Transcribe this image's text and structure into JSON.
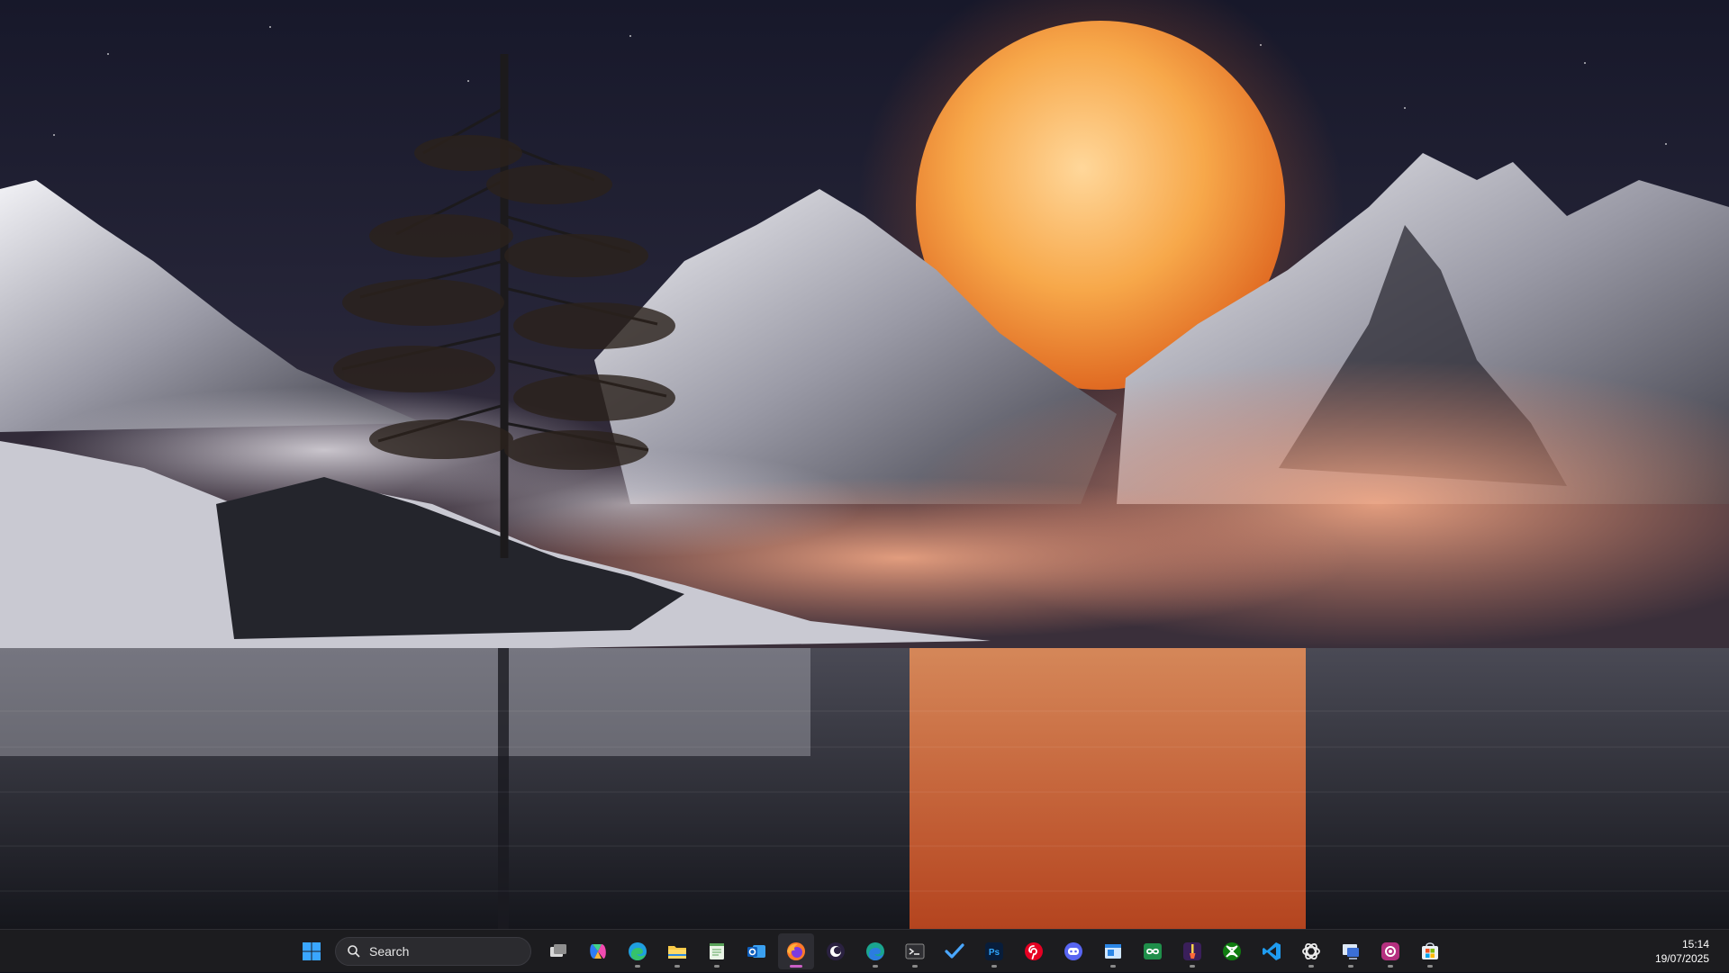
{
  "desktop": {
    "wallpaper": "night-mountain-lake-with-full-moon",
    "accent": "#f39a3c"
  },
  "taskbar": {
    "search": {
      "label": "Search",
      "icon": "search-icon"
    },
    "apps": [
      {
        "name": "start-button",
        "icon": "windows-logo-icon",
        "running": false,
        "active": false
      },
      {
        "name": "task-view-button",
        "icon": "task-view-icon",
        "running": false,
        "active": false
      },
      {
        "name": "copilot-button",
        "icon": "copilot-icon",
        "running": false,
        "active": false
      },
      {
        "name": "edge-button",
        "icon": "edge-icon",
        "running": false,
        "active": false
      },
      {
        "name": "file-explorer-button",
        "icon": "folder-icon",
        "running": true,
        "active": false
      },
      {
        "name": "notepad-button",
        "icon": "notepad-icon",
        "running": true,
        "active": false
      },
      {
        "name": "outlook-button",
        "icon": "outlook-icon",
        "running": false,
        "active": false
      },
      {
        "name": "firefox-button",
        "icon": "firefox-icon",
        "running": true,
        "active": true
      },
      {
        "name": "claude-button",
        "icon": "claude-icon",
        "running": false,
        "active": false
      },
      {
        "name": "edge-dev-button",
        "icon": "edge-dev-icon",
        "running": true,
        "active": false
      },
      {
        "name": "terminal-button",
        "icon": "terminal-icon",
        "running": true,
        "active": false
      },
      {
        "name": "todo-button",
        "icon": "checkmark-icon",
        "running": false,
        "active": false
      },
      {
        "name": "photoshop-button",
        "icon": "photoshop-icon",
        "running": true,
        "active": false
      },
      {
        "name": "pinterest-button",
        "icon": "pinterest-icon",
        "running": false,
        "active": false
      },
      {
        "name": "discord-button",
        "icon": "discord-icon",
        "running": false,
        "active": false
      },
      {
        "name": "window-app-button",
        "icon": "window-icon",
        "running": true,
        "active": false
      },
      {
        "name": "goodreads-button",
        "icon": "infinity-icon",
        "running": false,
        "active": false
      },
      {
        "name": "paintbrush-app-button",
        "icon": "paintbrush-icon",
        "running": true,
        "active": false
      },
      {
        "name": "xbox-button",
        "icon": "xbox-icon",
        "running": false,
        "active": false
      },
      {
        "name": "vscode-button",
        "icon": "vscode-icon",
        "running": false,
        "active": false
      },
      {
        "name": "chatgpt-button",
        "icon": "chatgpt-icon",
        "running": true,
        "active": false
      },
      {
        "name": "remote-desktop-button",
        "icon": "remote-desktop-icon",
        "running": true,
        "active": false
      },
      {
        "name": "screen-recorder-button",
        "icon": "screen-recorder-icon",
        "running": true,
        "active": false
      },
      {
        "name": "store-button",
        "icon": "store-icon",
        "running": true,
        "active": false
      }
    ],
    "clock": {
      "time": "15:14",
      "date": "19/07/2025"
    }
  }
}
